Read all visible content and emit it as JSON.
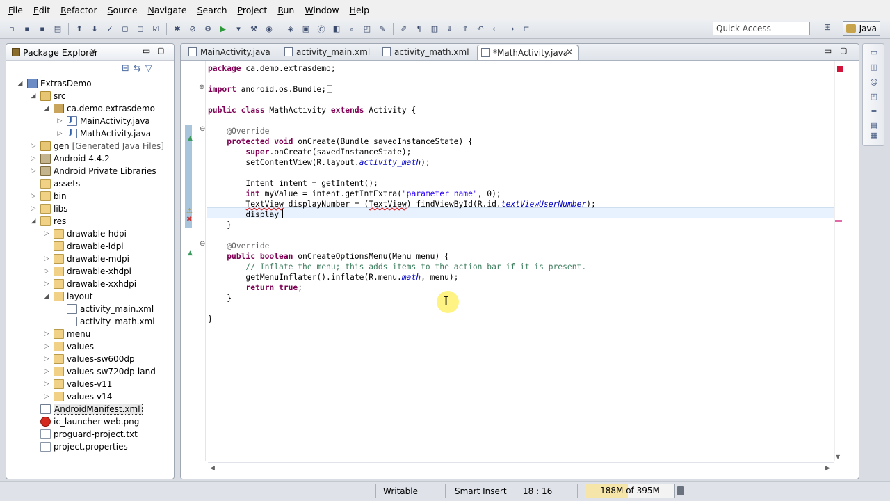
{
  "menu": [
    "File",
    "Edit",
    "Refactor",
    "Source",
    "Navigate",
    "Search",
    "Project",
    "Run",
    "Window",
    "Help"
  ],
  "quick_access": "Quick Access",
  "perspective": "Java",
  "package_explorer": {
    "title": "Package Explorer",
    "close_glyph": "✕",
    "collapse_all_glyph": "⊟",
    "link_glyph": "⇆",
    "menu_glyph": "▽",
    "minimize_glyph": "▭",
    "maximize_glyph": "▢",
    "items": [
      {
        "label": "ExtrasDemo",
        "twisty": "◢",
        "icon": "project-icon"
      },
      {
        "label": "src",
        "twisty": "◢",
        "icon": "source-folder-icon"
      },
      {
        "label": "ca.demo.extrasdemo",
        "twisty": "◢",
        "icon": "package-icon"
      },
      {
        "label": "MainActivity.java",
        "twisty": "▷",
        "icon": "java-file-icon"
      },
      {
        "label": "MathActivity.java",
        "twisty": "▷",
        "icon": "java-file-icon"
      },
      {
        "label": "gen",
        "extra": "[Generated Java Files]",
        "twisty": "▷",
        "icon": "source-folder-icon"
      },
      {
        "label": "Android 4.4.2",
        "twisty": "▷",
        "icon": "library-icon"
      },
      {
        "label": "Android Private Libraries",
        "twisty": "▷",
        "icon": "library-icon"
      },
      {
        "label": "assets",
        "twisty": "",
        "icon": "folder-icon"
      },
      {
        "label": "bin",
        "twisty": "▷",
        "icon": "folder-icon"
      },
      {
        "label": "libs",
        "twisty": "▷",
        "icon": "folder-icon"
      },
      {
        "label": "res",
        "twisty": "◢",
        "icon": "folder-icon"
      },
      {
        "label": "drawable-hdpi",
        "twisty": "▷",
        "icon": "folder-icon"
      },
      {
        "label": "drawable-ldpi",
        "twisty": "",
        "icon": "folder-icon"
      },
      {
        "label": "drawable-mdpi",
        "twisty": "▷",
        "icon": "folder-icon"
      },
      {
        "label": "drawable-xhdpi",
        "twisty": "▷",
        "icon": "folder-icon"
      },
      {
        "label": "drawable-xxhdpi",
        "twisty": "▷",
        "icon": "folder-icon"
      },
      {
        "label": "layout",
        "twisty": "◢",
        "icon": "folder-icon"
      },
      {
        "label": "activity_main.xml",
        "twisty": "",
        "icon": "xml-file-icon"
      },
      {
        "label": "activity_math.xml",
        "twisty": "",
        "icon": "xml-file-icon"
      },
      {
        "label": "menu",
        "twisty": "▷",
        "icon": "folder-icon"
      },
      {
        "label": "values",
        "twisty": "▷",
        "icon": "folder-icon"
      },
      {
        "label": "values-sw600dp",
        "twisty": "▷",
        "icon": "folder-icon"
      },
      {
        "label": "values-sw720dp-land",
        "twisty": "▷",
        "icon": "folder-icon"
      },
      {
        "label": "values-v11",
        "twisty": "▷",
        "icon": "folder-icon"
      },
      {
        "label": "values-v14",
        "twisty": "▷",
        "icon": "folder-icon"
      },
      {
        "label": "AndroidManifest.xml",
        "twisty": "",
        "icon": "xml-file-icon"
      },
      {
        "label": "ic_launcher-web.png",
        "twisty": "",
        "icon": "image-file-icon"
      },
      {
        "label": "proguard-project.txt",
        "twisty": "",
        "icon": "text-file-icon"
      },
      {
        "label": "project.properties",
        "twisty": "",
        "icon": "text-file-icon"
      }
    ]
  },
  "editor": {
    "tabs": [
      "MainActivity.java",
      "activity_main.xml",
      "activity_math.xml",
      "*MathActivity.java"
    ],
    "active_tab": 3,
    "tab_close_glyph": "✕",
    "fold_glyph": "⊖",
    "expand_glyph": "⊕",
    "override_glyph": "▲",
    "code": [
      "package ca.demo.extrasdemo;",
      "",
      "import android.os.Bundle;",
      "",
      "public class MathActivity extends Activity {",
      "",
      "@Override",
      "protected void onCreate(Bundle savedInstanceState) {",
      "super.onCreate(savedInstanceState);",
      "setContentView(R.layout.activity_math);",
      "",
      "Intent intent = getIntent();",
      "int myValue = intent.getIntExtra(\"parameter name\", 0);",
      "TextView displayNumber = (TextView) findViewById(R.id.textViewUserNumber);",
      "display",
      "}",
      "",
      "@Override",
      "public boolean onCreateOptionsMenu(Menu menu) {",
      "// Inflate the menu; this adds items to the action bar if it is present.",
      "getMenuInflater().inflate(R.menu.math, menu);",
      "return true;",
      "}",
      "",
      "}"
    ]
  },
  "status": {
    "writable": "Writable",
    "insert_mode": "Smart Insert",
    "position": "18 : 16",
    "heap": "188M of 395M",
    "heap_used_fraction": 0.476
  }
}
